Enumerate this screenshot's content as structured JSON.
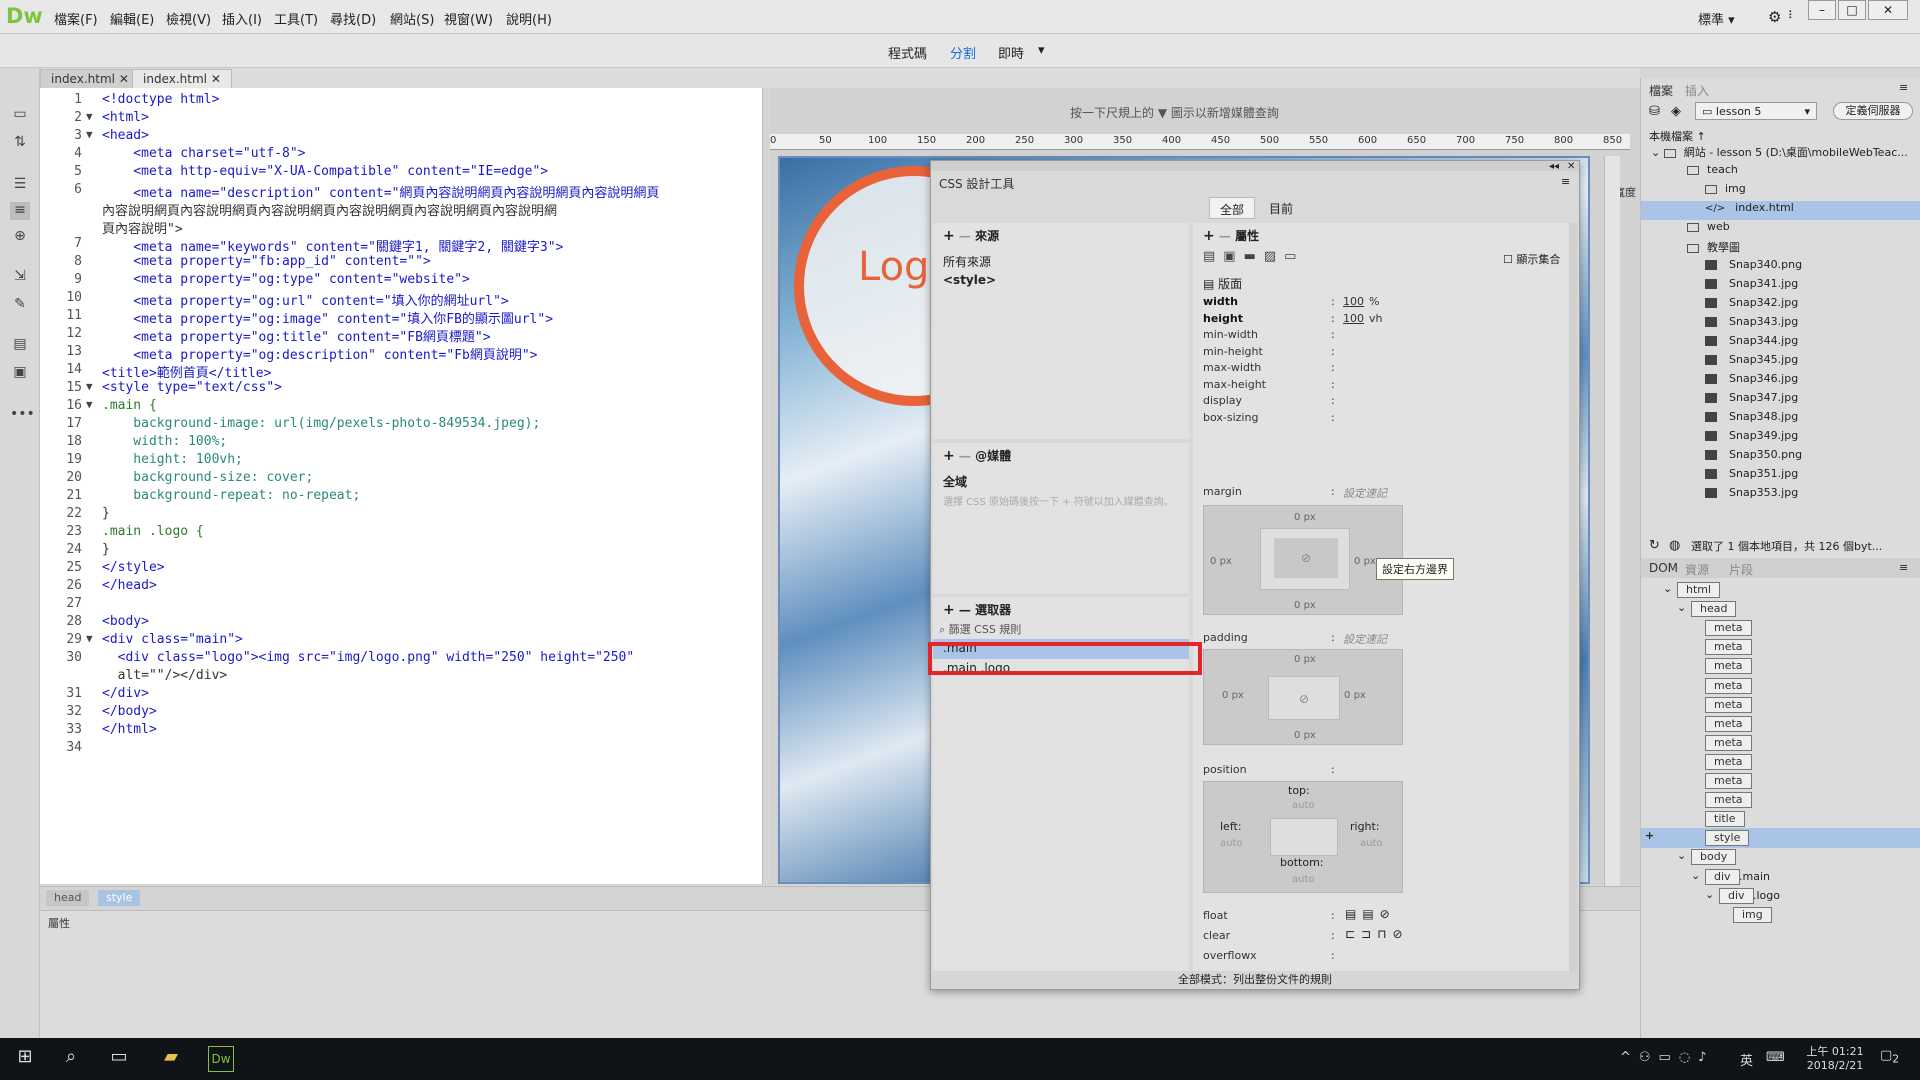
{
  "app": {
    "logo": "Dw"
  },
  "menu": [
    "檔案(F)",
    "編輯(E)",
    "檢視(V)",
    "插入(I)",
    "工具(T)",
    "尋找(D)",
    "網站(S)",
    "視窗(W)",
    "說明(H)"
  ],
  "workspace": {
    "label": "標準"
  },
  "views": {
    "code": "程式碼",
    "split": "分割",
    "live": "即時"
  },
  "doc_tabs": [
    "index.html",
    "index.html"
  ],
  "code_lines": [
    "<!doctype html>",
    "<html>",
    "<head>",
    "    <meta charset=\"utf-8\">",
    "    <meta http-equiv=\"X-UA-Compatible\" content=\"IE=edge\">",
    "    <meta name=\"description\" content=\"網頁內容說明網頁內容說明網頁內容說明網頁",
    "    <meta name=\"keywords\" content=\"關鍵字1, 關鍵字2, 關鍵字3\">",
    "    <meta property=\"fb:app_id\" content=\"\">",
    "    <meta property=\"og:type\" content=\"website\">",
    "    <meta property=\"og:url\" content=\"填入你的網址url\">",
    "    <meta property=\"og:image\" content=\"填入你FB的顯示圖url\">",
    "    <meta property=\"og:title\" content=\"FB網頁標題\">",
    "    <meta property=\"og:description\" content=\"Fb網頁說明\">",
    "<title>範例首頁</title>",
    "<style type=\"text/css\">",
    ".main {",
    "    background-image: url(img/pexels-photo-849534.jpeg);",
    "    width: 100%;",
    "    height: 100vh;",
    "    background-size: cover;",
    "    background-repeat: no-repeat;",
    "}",
    ".main .logo {",
    "}",
    "</style>",
    "</head>",
    "",
    "<body>",
    "<div class=\"main\">",
    "  <div class=\"logo\"><img src=\"img/logo.png\" width=\"250\" height=\"250\"",
    "  alt=\"\"/></div>",
    "</div>",
    "</body>",
    "</html>",
    ""
  ],
  "code_line_numbers": [
    "1",
    "2",
    "3",
    "4",
    "5",
    "6",
    "",
    "",
    "7",
    "8",
    "9",
    "10",
    "11",
    "12",
    "13",
    "14",
    "15",
    "16",
    "17",
    "18",
    "19",
    "20",
    "21",
    "22",
    "23",
    "24",
    "25",
    "26",
    "27",
    "28",
    "29",
    "30",
    "",
    "31",
    "32",
    "33",
    "34"
  ],
  "code_wrap_6b": "內容說明網頁內容說明網頁內容說明網頁內容說明網頁內容說明網頁內容說明網",
  "code_wrap_6c": "頁內容說明\">",
  "tag_selector": [
    "head",
    "style"
  ],
  "properties_label": "屬性",
  "design": {
    "hint": "按一下尺規上的",
    "hint2": "圖示以新增媒體查詢",
    "ruler_labels": [
      "0",
      "50",
      "100",
      "150",
      "200",
      "250",
      "300",
      "350",
      "400",
      "450",
      "500",
      "550",
      "600",
      "650",
      "700",
      "750",
      "800",
      "850"
    ],
    "logo_text": "Logo",
    "width_label": "寬度"
  },
  "css_designer": {
    "title": "CSS 設計工具",
    "seg_all": "全部",
    "seg_current": "目前",
    "sources_title": "來源",
    "sources": [
      "所有來源",
      "<style>"
    ],
    "media_title": "@媒體",
    "media_global": "全域",
    "media_hint": "選擇 CSS 原始碼後按一下 + 符號以加入媒體查詢。",
    "selectors_title": "選取器",
    "filter_placeholder": "篩選 CSS 規則",
    "selectors": [
      ".main",
      ".main .logo"
    ],
    "props_title": "屬性",
    "show_set": "顯示集合",
    "layout_label": "版面",
    "props": [
      {
        "name": "width",
        "value": "100",
        "unit": "%"
      },
      {
        "name": "height",
        "value": "100",
        "unit": "vh"
      },
      {
        "name": "min-width",
        "value": "",
        "unit": ""
      },
      {
        "name": "min-height",
        "value": "",
        "unit": ""
      },
      {
        "name": "max-width",
        "value": "",
        "unit": ""
      },
      {
        "name": "max-height",
        "value": "",
        "unit": ""
      },
      {
        "name": "display",
        "value": "",
        "unit": ""
      },
      {
        "name": "box-sizing",
        "value": "",
        "unit": ""
      }
    ],
    "margin_label": "margin",
    "padding_label": "padding",
    "set_shorthand": "設定速記",
    "box_zero": "0",
    "box_unit": "px",
    "position_label": "position",
    "pos_top": "top:",
    "pos_right": "right:",
    "pos_bottom": "bottom:",
    "pos_left": "left:",
    "auto": "auto",
    "float_label": "float",
    "clear_label": "clear",
    "overflowx_label": "overflowx",
    "footer": "全部模式：列出整份文件的規則",
    "tooltip": "設定右方邊界"
  },
  "files": {
    "tabs": [
      "檔案",
      "插入"
    ],
    "site": "lesson 5",
    "manage": "定義伺服器",
    "local_files": "本機檔案",
    "root": "網站 - lesson 5 (D:\\桌面\\mobileWebTeac...",
    "tree": [
      {
        "label": "teach",
        "type": "folder",
        "level": 1
      },
      {
        "label": "img",
        "type": "folder",
        "level": 2
      },
      {
        "label": "index.html",
        "type": "file",
        "level": 2,
        "selected": true
      },
      {
        "label": "web",
        "type": "folder",
        "level": 1
      },
      {
        "label": "教學圖",
        "type": "folder",
        "level": 1
      },
      {
        "label": "Snap340.png",
        "type": "image",
        "level": 2
      },
      {
        "label": "Snap341.jpg",
        "type": "image",
        "level": 2
      },
      {
        "label": "Snap342.jpg",
        "type": "image",
        "level": 2
      },
      {
        "label": "Snap343.jpg",
        "type": "image",
        "level": 2
      },
      {
        "label": "Snap344.jpg",
        "type": "image",
        "level": 2
      },
      {
        "label": "Snap345.jpg",
        "type": "image",
        "level": 2
      },
      {
        "label": "Snap346.jpg",
        "type": "image",
        "level": 2
      },
      {
        "label": "Snap347.jpg",
        "type": "image",
        "level": 2
      },
      {
        "label": "Snap348.jpg",
        "type": "image",
        "level": 2
      },
      {
        "label": "Snap349.jpg",
        "type": "image",
        "level": 2
      },
      {
        "label": "Snap350.png",
        "type": "image",
        "level": 2
      },
      {
        "label": "Snap351.jpg",
        "type": "image",
        "level": 2
      },
      {
        "label": "Snap353.jpg",
        "type": "image",
        "level": 2
      }
    ],
    "status": "選取了 1 個本地項目，共 126 個byt..."
  },
  "dom": {
    "tabs": [
      "DOM",
      "資源",
      "片段"
    ],
    "nodes": [
      {
        "tag": "html",
        "level": 0,
        "arrow": true
      },
      {
        "tag": "head",
        "level": 1,
        "arrow": true
      },
      {
        "tag": "meta",
        "level": 2
      },
      {
        "tag": "meta",
        "level": 2
      },
      {
        "tag": "meta",
        "level": 2
      },
      {
        "tag": "meta",
        "level": 2
      },
      {
        "tag": "meta",
        "level": 2
      },
      {
        "tag": "meta",
        "level": 2
      },
      {
        "tag": "meta",
        "level": 2
      },
      {
        "tag": "meta",
        "level": 2
      },
      {
        "tag": "meta",
        "level": 2
      },
      {
        "tag": "meta",
        "level": 2
      },
      {
        "tag": "title",
        "level": 2
      },
      {
        "tag": "style",
        "level": 2,
        "selected": true
      },
      {
        "tag": "body",
        "level": 1,
        "arrow": true
      },
      {
        "tag": "div",
        "level": 2,
        "arrow": true,
        "cls": ".main"
      },
      {
        "tag": "div",
        "level": 3,
        "arrow": true,
        "cls": ".logo"
      },
      {
        "tag": "img",
        "level": 4
      }
    ]
  },
  "taskbar": {
    "time": "上午 01:21",
    "date": "2018/2/21",
    "ime": "英",
    "notif": "2"
  }
}
